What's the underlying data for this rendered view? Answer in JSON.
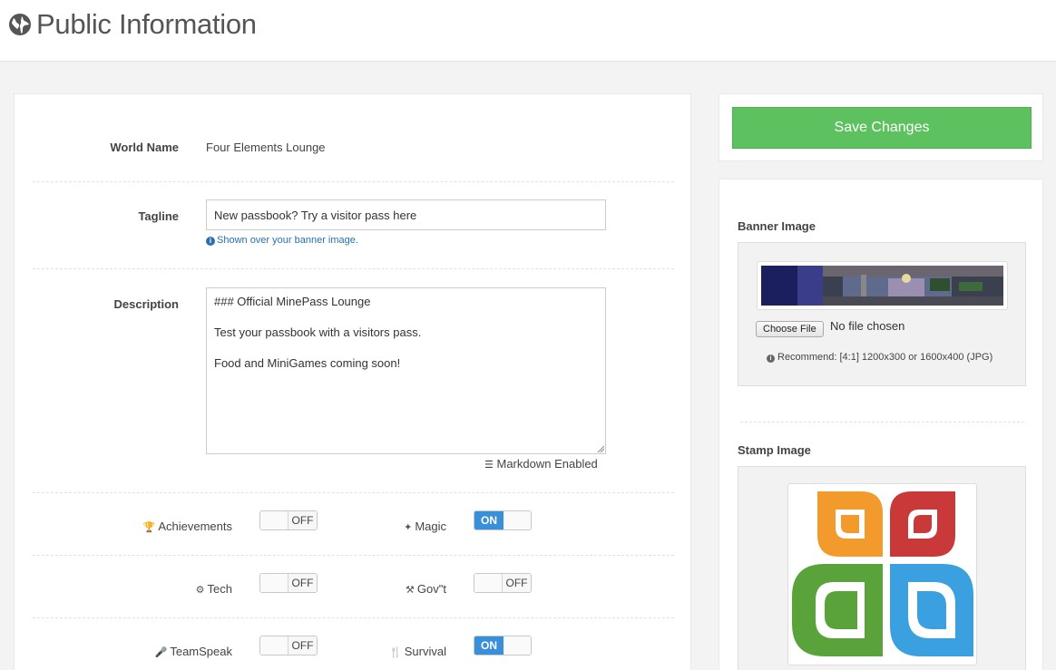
{
  "header": {
    "title": "Public Information",
    "icon": "globe-icon"
  },
  "form": {
    "world_name": {
      "label": "World Name",
      "value": "Four Elements Lounge"
    },
    "tagline": {
      "label": "Tagline",
      "value": "New passbook? Try a visitor pass here",
      "help": "Shown over your banner image."
    },
    "description": {
      "label": "Description",
      "lines": [
        "### Official MinePass Lounge",
        "Test your passbook with a visitors pass.",
        "Food and MiniGames coming soon!"
      ],
      "markdown_note": "Markdown Enabled"
    },
    "toggles": [
      {
        "label": "Achievements",
        "icon": "trophy-icon",
        "state": "OFF"
      },
      {
        "label": "Magic",
        "icon": "magic-wand-icon",
        "state": "ON"
      },
      {
        "label": "Tech",
        "icon": "gears-icon",
        "state": "OFF"
      },
      {
        "label": "Gov\"t",
        "icon": "gavel-icon",
        "state": "OFF"
      },
      {
        "label": "TeamSpeak",
        "icon": "microphone-icon",
        "state": "OFF"
      },
      {
        "label": "Survival",
        "icon": "cutlery-icon",
        "state": "ON"
      }
    ]
  },
  "save_label": "Save Changes",
  "banner": {
    "title": "Banner Image",
    "choose_label": "Choose File",
    "file_status": "No file chosen",
    "recommend": "Recommend: [4:1] 1200x300 or 1600x400 (JPG)"
  },
  "stamp": {
    "title": "Stamp Image"
  },
  "colors": {
    "accent": "#3a8fd9",
    "save": "#5cc15e",
    "link": "#2a6fb0"
  }
}
